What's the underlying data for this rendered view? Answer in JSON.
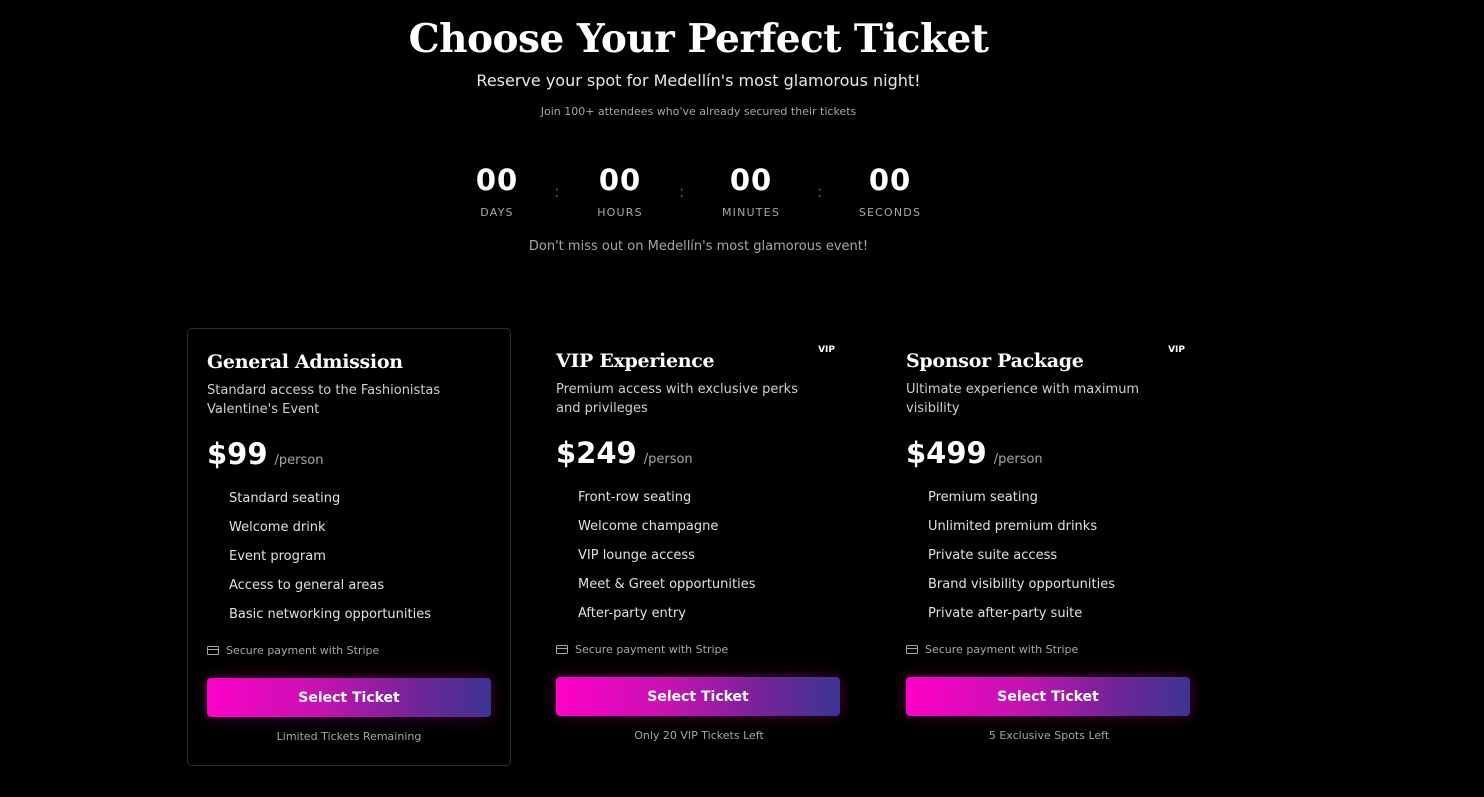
{
  "header": {
    "title": "Choose Your Perfect Ticket",
    "subtitle": "Reserve your spot for Medellín's most glamorous night!",
    "social_proof": "Join 100+ attendees who've already secured their tickets"
  },
  "countdown": {
    "separator": ":",
    "units": [
      {
        "value": "00",
        "label": "DAYS"
      },
      {
        "value": "00",
        "label": "HOURS"
      },
      {
        "value": "00",
        "label": "MINUTES"
      },
      {
        "value": "00",
        "label": "SECONDS"
      }
    ],
    "notice": "Don't miss out on Medellín's most glamorous event!"
  },
  "tickets": [
    {
      "title": "General Admission",
      "badge": "",
      "description": "Standard access to the Fashionistas Valentine's Event",
      "price": "$99",
      "per": "/person",
      "features": [
        "Standard seating",
        "Welcome drink",
        "Event program",
        "Access to general areas",
        "Basic networking opportunities"
      ],
      "secure": "Secure payment with Stripe",
      "button": "Select Ticket",
      "availability": "Limited Tickets Remaining"
    },
    {
      "title": "VIP Experience",
      "badge": "VIP",
      "description": "Premium access with exclusive perks and privileges",
      "price": "$249",
      "per": "/person",
      "features": [
        "Front-row seating",
        "Welcome champagne",
        "VIP lounge access",
        "Meet & Greet opportunities",
        "After-party entry"
      ],
      "secure": "Secure payment with Stripe",
      "button": "Select Ticket",
      "availability": "Only 20 VIP Tickets Left"
    },
    {
      "title": "Sponsor Package",
      "badge": "VIP",
      "description": "Ultimate experience with maximum visibility",
      "price": "$499",
      "per": "/person",
      "features": [
        "Premium seating",
        "Unlimited premium drinks",
        "Private suite access",
        "Brand visibility opportunities",
        "Private after-party suite"
      ],
      "secure": "Secure payment with Stripe",
      "button": "Select Ticket",
      "availability": "5 Exclusive Spots Left"
    }
  ],
  "colors": {
    "background": "#000000",
    "gradient_start": "#ff00c8",
    "gradient_end": "#3d3493",
    "muted_text": "#a6a6a6"
  }
}
